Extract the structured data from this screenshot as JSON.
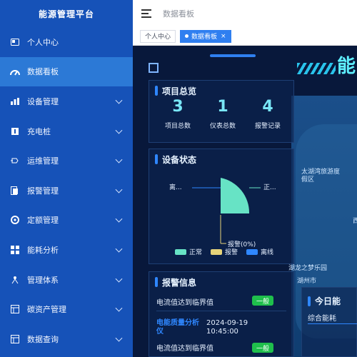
{
  "app": {
    "brand": "能源管理平台",
    "breadcrumb": "数据看板"
  },
  "sidebar": {
    "items": [
      {
        "label": "个人中心",
        "icon": "user-card-icon",
        "active": false,
        "has_chevron": false
      },
      {
        "label": "数据看板",
        "icon": "dashboard-icon",
        "active": true,
        "has_chevron": false
      },
      {
        "label": "设备管理",
        "icon": "bar-chart-icon",
        "active": false,
        "has_chevron": true
      },
      {
        "label": "充电桩",
        "icon": "charging-pile-icon",
        "active": false,
        "has_chevron": true
      },
      {
        "label": "运维管理",
        "icon": "maintenance-icon",
        "active": false,
        "has_chevron": true
      },
      {
        "label": "报警管理",
        "icon": "alarm-icon",
        "active": false,
        "has_chevron": true
      },
      {
        "label": "定额管理",
        "icon": "quota-icon",
        "active": false,
        "has_chevron": true
      },
      {
        "label": "能耗分析",
        "icon": "grid-icon",
        "active": false,
        "has_chevron": true
      },
      {
        "label": "管理体系",
        "icon": "management-icon",
        "active": false,
        "has_chevron": true
      },
      {
        "label": "碳资产管理",
        "icon": "carbon-icon",
        "active": false,
        "has_chevron": true
      },
      {
        "label": "数据查询",
        "icon": "query-icon",
        "active": false,
        "has_chevron": true
      }
    ]
  },
  "tabs": [
    {
      "label": "个人中心",
      "active": false
    },
    {
      "label": "数据看板",
      "active": true,
      "close": "×"
    }
  ],
  "dashboard": {
    "big_title": "能",
    "overview": {
      "title": "项目总览",
      "items": [
        {
          "value": "3",
          "label": "项目总数"
        },
        {
          "value": "1",
          "label": "仪表总数"
        },
        {
          "value": "4",
          "label": "报警记录"
        }
      ]
    },
    "device_status": {
      "title": "设备状态",
      "label_offline": "离...",
      "label_normal": "正...",
      "label_alarm": "报警(0%)",
      "legend": [
        {
          "label": "正常",
          "color": "#67e3c5"
        },
        {
          "label": "报警",
          "color": "#e6d37a"
        },
        {
          "label": "离线",
          "color": "#2f87ff"
        }
      ]
    },
    "alerts": {
      "title": "报警信息",
      "rows": [
        {
          "text": "电流值达到临界值",
          "level": "一般"
        },
        {
          "device": "电能质量分析仪",
          "date": "2024-09-19",
          "time": "10:45:00"
        },
        {
          "text": "电流值达到临界值",
          "level": "一般"
        }
      ]
    },
    "today": {
      "title": "今日能",
      "subtitle": "综合能耗"
    },
    "map_labels": [
      "太湖湾旅游度假区",
      "湖龙之梦乐园",
      "湖州市",
      "西"
    ]
  }
}
